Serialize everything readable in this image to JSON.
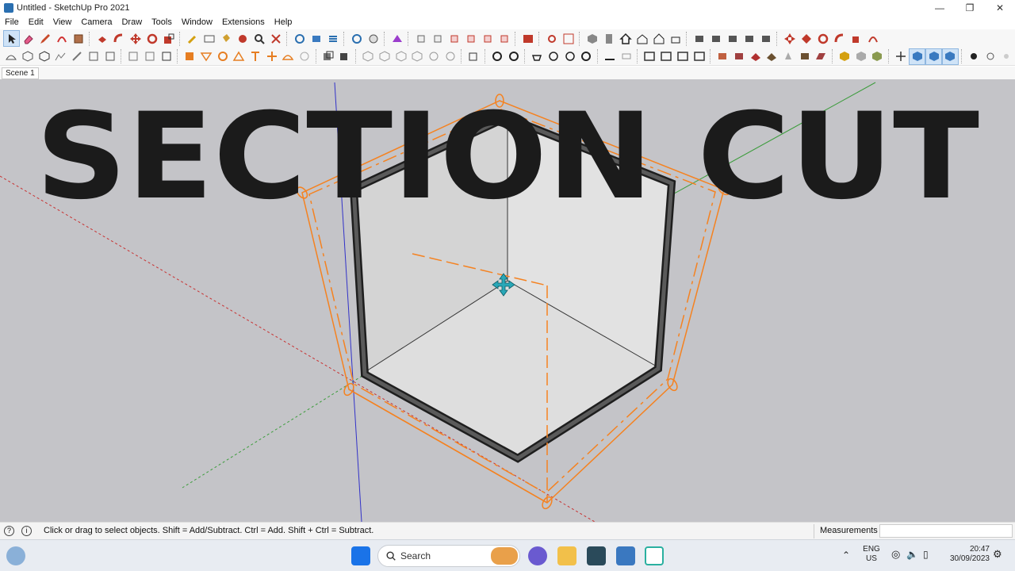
{
  "window": {
    "title": "Untitled - SketchUp Pro 2021"
  },
  "menu": [
    "File",
    "Edit",
    "View",
    "Camera",
    "Draw",
    "Tools",
    "Window",
    "Extensions",
    "Help"
  ],
  "scene_tab": "Scene 1",
  "overlay_text": "SECTION CUT",
  "status": {
    "message": "Click or drag to select objects. Shift = Add/Subtract. Ctrl = Add. Shift + Ctrl = Subtract.",
    "measurements_label": "Measurements"
  },
  "taskbar": {
    "search_label": "Search",
    "language": "ENG",
    "region": "US",
    "time": "20:47",
    "date": "30/09/2023"
  },
  "colors": {
    "section_plane": "#f58220",
    "axis_red": "#c83232",
    "axis_green": "#3c9c3c",
    "axis_blue": "#3232c8",
    "move_cursor": "#29a8b8",
    "overlay_text": "#1b1b1b"
  }
}
